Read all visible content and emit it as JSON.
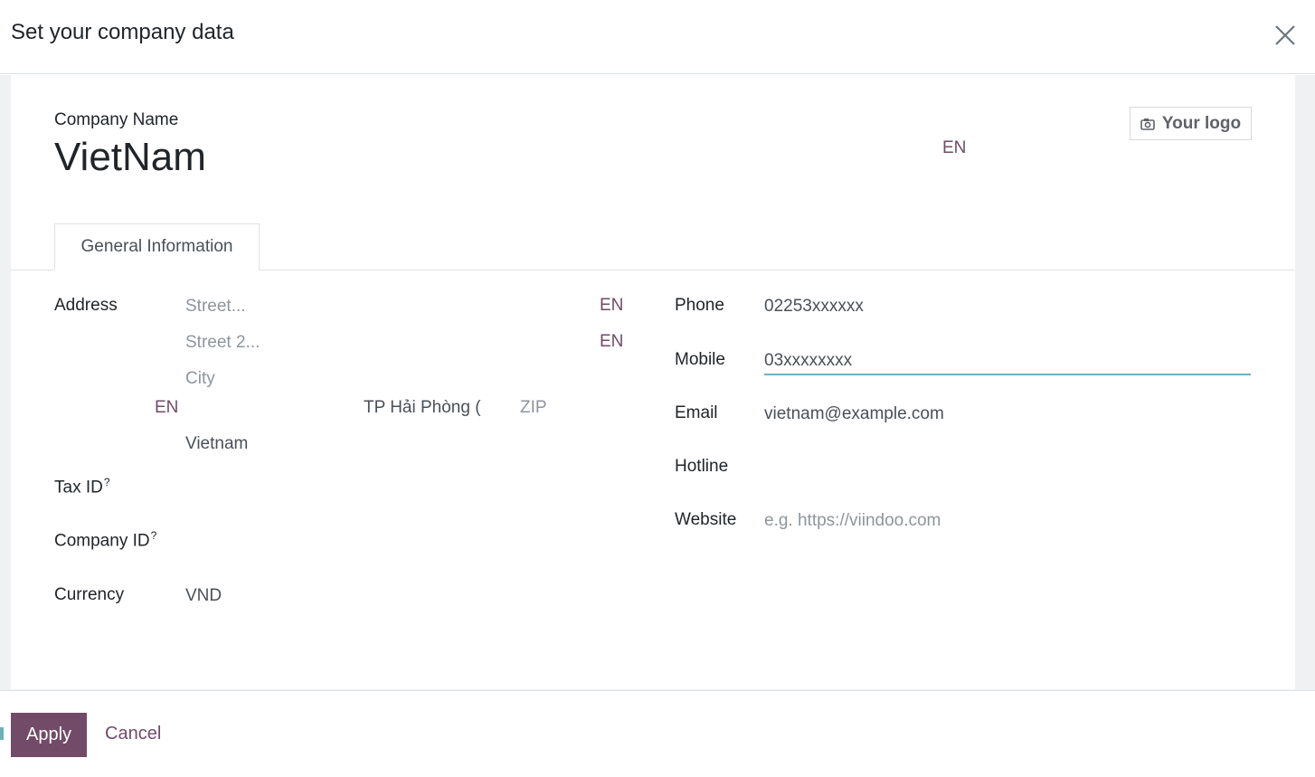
{
  "dialog": {
    "title": "Set your company data",
    "close_icon": "close-icon"
  },
  "company": {
    "name_label": "Company Name",
    "name_value": "VietNam",
    "name_lang": "EN",
    "logo_button_label": "Your logo",
    "logo_icon": "camera-icon"
  },
  "tabs": [
    {
      "label": "General Information",
      "active": true
    }
  ],
  "address": {
    "label": "Address",
    "street_placeholder": "Street...",
    "street_lang": "EN",
    "street2_placeholder": "Street 2...",
    "street2_lang": "EN",
    "city_placeholder": "City",
    "city_lang": "EN",
    "state_value": "TP Hải Phòng (",
    "zip_placeholder": "ZIP",
    "country_value": "Vietnam"
  },
  "tax_id": {
    "label": "Tax ID",
    "help": "?"
  },
  "company_id": {
    "label": "Company ID",
    "help": "?"
  },
  "currency": {
    "label": "Currency",
    "value": "VND"
  },
  "contact": {
    "phone_label": "Phone",
    "phone_value": "02253xxxxxx",
    "mobile_label": "Mobile",
    "mobile_value": "03xxxxxxxx",
    "email_label": "Email",
    "email_value": "vietnam@example.com",
    "hotline_label": "Hotline",
    "hotline_value": "",
    "website_label": "Website",
    "website_placeholder": "e.g. https://viindoo.com"
  },
  "footer": {
    "apply_label": "Apply",
    "cancel_label": "Cancel"
  },
  "colors": {
    "brand": "#714b67",
    "focus_underline": "#6ab3b9"
  }
}
